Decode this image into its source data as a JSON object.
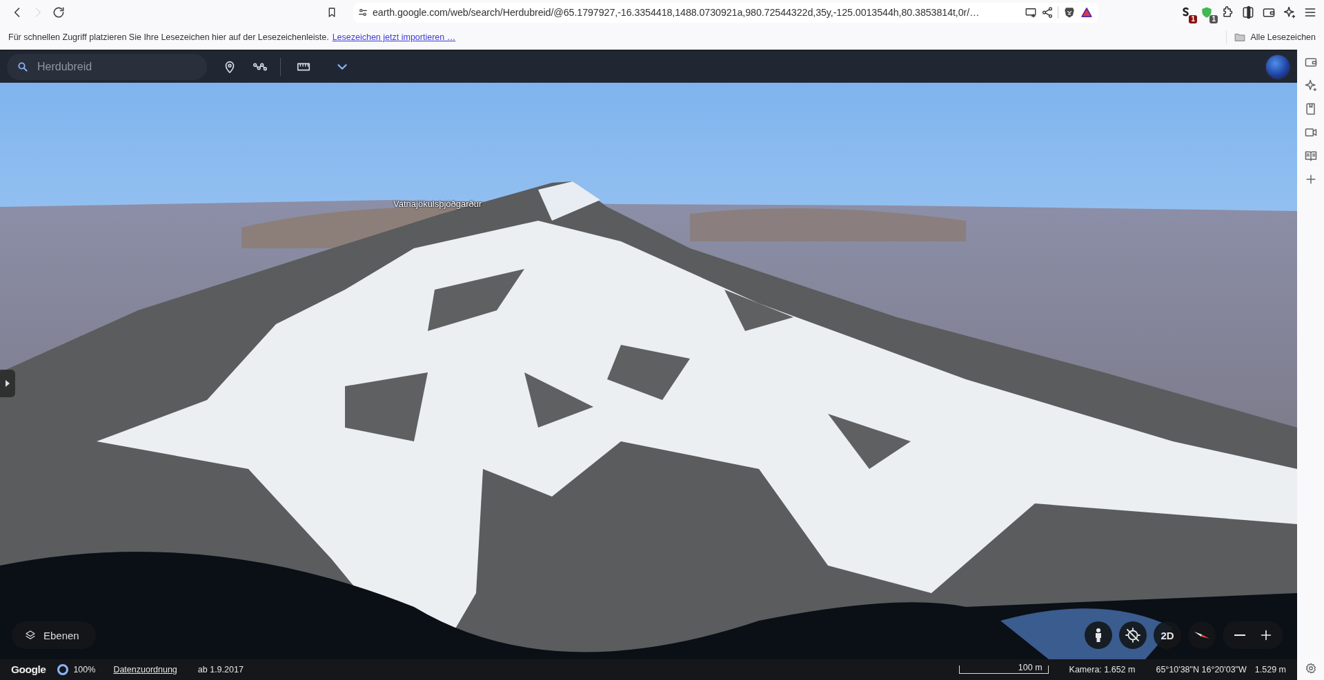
{
  "browser": {
    "nav_buttons": [
      {
        "kind": "back",
        "disabled": false
      },
      {
        "kind": "forward",
        "disabled": true
      },
      {
        "kind": "reload",
        "disabled": false
      }
    ],
    "url": "earth.google.com/web/search/Herdubreid/@65.1797927,-16.3354418,1488.0730921a,980.72544322d,35y,-125.0013544h,80.3853814t,0r/…",
    "extension_badges": [
      "1",
      "1"
    ],
    "bookmarks_bar": {
      "hint": "Für schnellen Zugriff platzieren Sie Ihre Lesezeichen hier auf der Lesezeichenleiste.",
      "import_link": "Lesezeichen jetzt importieren …",
      "all_bookmarks": "Alle Lesezeichen"
    }
  },
  "earth": {
    "search": {
      "value": "Herdubreid"
    },
    "map_label": "Vatnajökulsþjóðgarður",
    "layers_button": "Ebenen",
    "view_mode_button": "2D",
    "status_bar": {
      "logo": "Google",
      "loading": {
        "reading": "100%",
        "level": 1
      },
      "attribution_link": "Datenzuordnung",
      "imagery_date": "ab 1.9.2017",
      "scale": "100 m",
      "camera": "Kamera: 1.652 m",
      "coordinates": "65°10'38\"N 16°20'03\"W",
      "elevation": "1.529 m"
    }
  }
}
